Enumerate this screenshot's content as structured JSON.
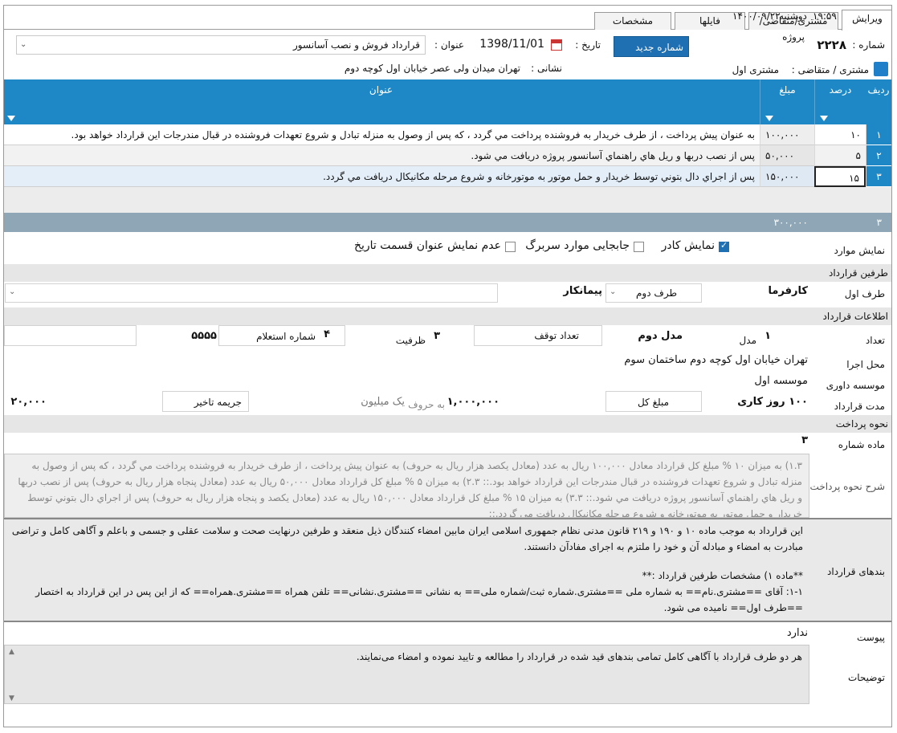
{
  "status": {
    "time": "۱۹:۵۹",
    "day": "دوشنبه",
    "date": "۱۴۰۰/۰۹/۲۲"
  },
  "tabs": [
    "ویرایش",
    "مشتری/متقاضی/پروژه",
    "فایلها",
    "مشخصات"
  ],
  "header": {
    "number_label": "شماره :",
    "number_value": "۲۲۲۸",
    "new_number_button": "شماره جدید",
    "date_label": "تاریخ :",
    "date_value": "1398/11/01",
    "title_label": "عنوان :",
    "title_value": "قرارداد فروش و نصب آسانسور",
    "customer_label": "مشتری / متقاضی :",
    "customer_value": "مشتری اول",
    "address_label": "نشانی :",
    "address_value": "تهران میدان ولی عصر خیابان اول کوچه دوم"
  },
  "grid": {
    "columns": [
      "ردیف",
      "درصد",
      "مبلغ",
      "عنوان"
    ],
    "rows": [
      {
        "num": "۱",
        "percent": "۱۰",
        "amount": "۱۰۰,۰۰۰",
        "title": "به عنوان پيش پرداخت ، از طرف خريدار به فروشنده پرداخت مي گردد ، كه پس از وصول به منزله تبادل و شروع تعهدات فروشنده در قبال مندرجات اين قرارداد خواهد بود."
      },
      {
        "num": "۲",
        "percent": "۵",
        "amount": "۵۰,۰۰۰",
        "title": "پس از نصب دربها و ريل هاي راهنماي آسانسور پروژه دريافت مي شود."
      },
      {
        "num": "۳",
        "percent": "۱۵",
        "amount": "۱۵۰,۰۰۰",
        "title": "پس از اجراي دال بتوني توسط خريدار و حمل موتور به موتورخانه و شروع مرحله مكانيكال دريافت مي گردد."
      }
    ],
    "footer_count": "۳",
    "footer_total": "۳۰۰,۰۰۰"
  },
  "display": {
    "label": "نمایش موارد",
    "show_border": "نمایش کادر",
    "move_header": "جابجایی موارد سربرگ",
    "hide_title": "عدم نمایش عنوان قسمت تاریخ"
  },
  "parties": {
    "section": "طرفین قرارداد",
    "party1_label": "طرف اول",
    "party1_value": "کارفرما",
    "party2_select": "طرف دوم",
    "party2_value": "پیمانکار"
  },
  "info": {
    "section": "اطلاعات قرارداد",
    "count_label": "تعداد",
    "count_value": "۱",
    "model_label": "مدل",
    "model_value": "مدل دوم",
    "stops_label": "تعداد توقف",
    "capacity_value": "۳",
    "capacity_label": "ظرفیت",
    "inquiry_value": "۴",
    "inquiry_label": "شماره استعلام",
    "inquiry_number": "۵۵۵۵",
    "location_label": "محل اجرا",
    "location_value": "تهران خیابان اول کوچه دوم ساختمان سوم",
    "arbitration_label": "موسسه داوری",
    "arbitration_value": "موسسه اول",
    "duration_label": "مدت قرارداد",
    "duration_value": "۱۰۰ روز کاری",
    "total_label": "مبلغ کل",
    "total_value": "۱,۰۰۰,۰۰۰",
    "in_words_label": "به حروف",
    "in_words_value": "یک میلیون",
    "penalty_label": "جریمه تاخیر",
    "penalty_value": "۲۰,۰۰۰"
  },
  "payment": {
    "section": "نحوه پرداخت",
    "article_label": "ماده شماره",
    "article_value": "۳",
    "desc_label": "شرح نحوه پرداخت",
    "desc_text": "۱.۳) به میزان ۱۰ % مبلغ کل قرارداد معادل ۱۰۰,۰۰۰ ریال به عدد (معادل یکصد  هزار ریال به حروف) به عنوان پيش پرداخت ، از طرف خريدار به فروشنده پرداخت مي گردد ، كه پس از وصول به منزله تبادل و شروع تعهدات فروشنده در قبال مندرجات اين قرارداد خواهد بود.:: ۲.۳) به میزان ۵ % مبلغ کل قرارداد معادل ۵۰,۰۰۰ ریال به عدد (معادل پنجاه  هزار ریال به حروف) پس از نصب دربها و ريل هاي راهنماي آسانسور پروژه دريافت مي شود.:: ۳.۳) به میزان ۱۵ % مبلغ کل قرارداد معادل ۱۵۰,۰۰۰ ریال به عدد (معادل یکصد و پنجاه  هزار ریال به حروف) پس از اجراي دال بتوني توسط خريدار و حمل موتور به موتورخانه و شروع مرحله مكانيكال دريافت مي گردد.::"
  },
  "clauses": {
    "label": "بندهای قرارداد",
    "line1": "این قرارداد به موجب ماده ۱۰ و ۱۹۰ و ۲۱۹ قانون مدنی  نظام جمهوری اسلامی ایران مابین امضاء کنندگان ذیل منعقد و طرفین درنهایت صحت و سلامت عقلی و جسمی و باعلم و آگاهی کامل و تراضی مبادرت به امضاء و مبادله آن و خود را ملتزم به اجرای مفادآن دانستند.",
    "line2": "**ماده ۱) مشخصات طرفین قرارداد :**",
    "line3": "۱-۱: آقای ==مشتری.نام==  به شماره ملی ==مشتری.شماره ثبت/شماره ملی== به نشانی ==مشتری.نشانی== تلفن همراه  ==مشتری.همراه== که از این پس در این قرارداد به اختصار ==طرف اول== نامیده می شود."
  },
  "attachment": {
    "label": "پیوست",
    "value": "ندارد"
  },
  "notes": {
    "label": "توضیحات",
    "value": "هر دو طرف قرارداد با آگاهی کامل تمامی بندهای قید شده در قرارداد را مطالعه و تایید نموده و امضاء می‌نمایند."
  },
  "colors": {
    "accent": "#1e88c7",
    "button": "#1f6fb3",
    "section": "#e6e6e6",
    "footer": "#8ea6b5"
  },
  "icons": [
    "calendar-icon",
    "filter-icon",
    "customer-icon",
    "chevron-down-icon",
    "checkbox-icon"
  ]
}
